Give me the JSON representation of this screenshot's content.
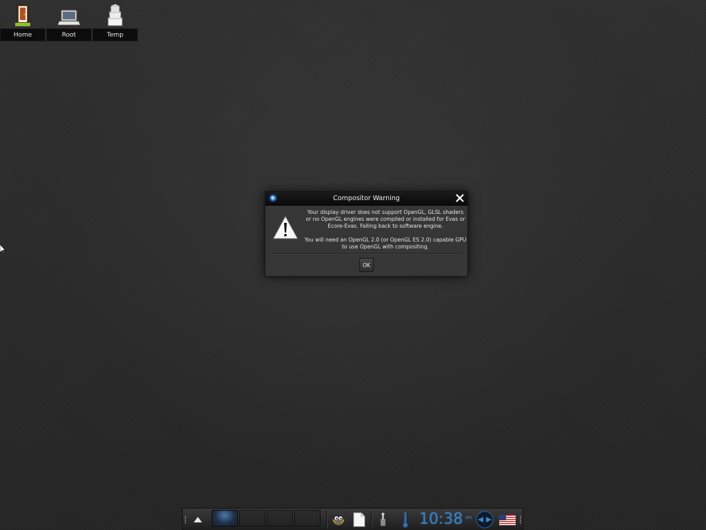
{
  "desktop": {
    "icons": [
      {
        "label": "Home",
        "icon": "home-door-icon"
      },
      {
        "label": "Root",
        "icon": "computer-laptop-icon"
      },
      {
        "label": "Temp",
        "icon": "temp-folder-icon"
      }
    ]
  },
  "dialog": {
    "title": "Compositor Warning",
    "message_line1": "Your display driver does not support OpenGL, GLSL shaders or no OpenGL engines were compiled or installed for Evas or Ecore-Evas. Falling back to software engine.",
    "message_line2": "You will need an OpenGL 2.0 (or OpenGL ES 2.0) capable GPU to use OpenGL with compositing.",
    "ok_label": "OK",
    "icons": {
      "app": "enlightenment-logo-icon",
      "close": "close-icon",
      "warning": "warning-triangle-icon"
    }
  },
  "shelf": {
    "start_icon": "up-arrow-icon",
    "pager_desktops": 4,
    "active_desktop": 1,
    "clock": "10:38",
    "clock_ampm": "AM",
    "tray_icons": [
      "gimp-icon",
      "document-icon",
      "mixer-icon",
      "thermometer-icon",
      "clock-icon",
      "cpufreq-icon",
      "flag-icon"
    ]
  },
  "colors": {
    "accent_blue": "#3c84c8",
    "background": "#2c2c2c"
  }
}
